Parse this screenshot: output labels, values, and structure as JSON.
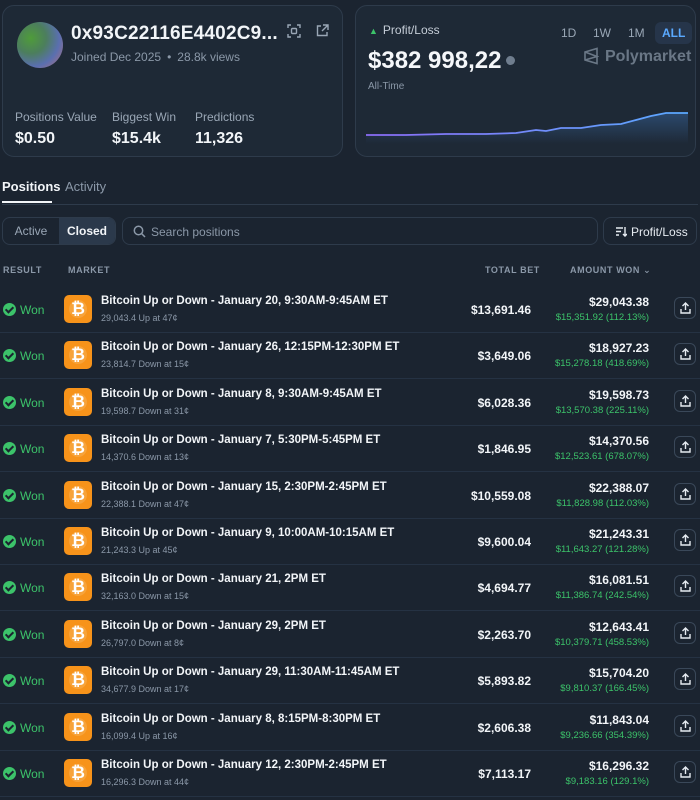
{
  "profile": {
    "address": "0x93C22116E4402C9...",
    "joined": "Joined Dec 2025",
    "views": "28.8k views",
    "stats": [
      {
        "label": "Positions Value",
        "value": "$0.50"
      },
      {
        "label": "Biggest Win",
        "value": "$15.4k"
      },
      {
        "label": "Predictions",
        "value": "11,326"
      }
    ]
  },
  "pnl": {
    "label": "Profit/Loss",
    "value": "$382 998,22",
    "period": "All-Time",
    "ranges": [
      "1D",
      "1W",
      "1M",
      "ALL"
    ],
    "active_range": "ALL",
    "brand": "Polymarket",
    "line_color": "#8b6cf6",
    "line_color_end": "#5aa9ff"
  },
  "tabs": {
    "positions": "Positions",
    "activity": "Activity"
  },
  "filters": {
    "active": "Active",
    "closed": "Closed",
    "search_placeholder": "Search positions",
    "sort_label": "Profit/Loss"
  },
  "table": {
    "headers": {
      "result": "RESULT",
      "market": "MARKET",
      "total_bet": "TOTAL BET",
      "amount_won": "AMOUNT WON"
    },
    "rows": [
      {
        "result": "Won",
        "title": "Bitcoin Up or Down - January 20, 9:30AM-9:45AM ET",
        "sub": "29,043.4 Up at 47¢",
        "bet": "$13,691.46",
        "won": "$29,043.38",
        "pct": "$15,351.92 (112.13%)"
      },
      {
        "result": "Won",
        "title": "Bitcoin Up or Down - January 26, 12:15PM-12:30PM ET",
        "sub": "23,814.7 Down at 15¢",
        "bet": "$3,649.06",
        "won": "$18,927.23",
        "pct": "$15,278.18 (418.69%)"
      },
      {
        "result": "Won",
        "title": "Bitcoin Up or Down - January 8, 9:30AM-9:45AM ET",
        "sub": "19,598.7 Down at 31¢",
        "bet": "$6,028.36",
        "won": "$19,598.73",
        "pct": "$13,570.38 (225.11%)"
      },
      {
        "result": "Won",
        "title": "Bitcoin Up or Down - January 7, 5:30PM-5:45PM ET",
        "sub": "14,370.6 Down at 13¢",
        "bet": "$1,846.95",
        "won": "$14,370.56",
        "pct": "$12,523.61 (678.07%)"
      },
      {
        "result": "Won",
        "title": "Bitcoin Up or Down - January 15, 2:30PM-2:45PM ET",
        "sub": "22,388.1 Down at 47¢",
        "bet": "$10,559.08",
        "won": "$22,388.07",
        "pct": "$11,828.98 (112.03%)"
      },
      {
        "result": "Won",
        "title": "Bitcoin Up or Down - January 9, 10:00AM-10:15AM ET",
        "sub": "21,243.3 Up at 45¢",
        "bet": "$9,600.04",
        "won": "$21,243.31",
        "pct": "$11,643.27 (121.28%)"
      },
      {
        "result": "Won",
        "title": "Bitcoin Up or Down - January 21, 2PM ET",
        "sub": "32,163.0 Down at 15¢",
        "bet": "$4,694.77",
        "won": "$16,081.51",
        "pct": "$11,386.74 (242.54%)"
      },
      {
        "result": "Won",
        "title": "Bitcoin Up or Down - January 29, 2PM ET",
        "sub": "26,797.0 Down at 8¢",
        "bet": "$2,263.70",
        "won": "$12,643.41",
        "pct": "$10,379.71 (458.53%)"
      },
      {
        "result": "Won",
        "title": "Bitcoin Up or Down - January 29, 11:30AM-11:45AM ET",
        "sub": "34,677.9 Down at 17¢",
        "bet": "$5,893.82",
        "won": "$15,704.20",
        "pct": "$9,810.37 (166.45%)"
      },
      {
        "result": "Won",
        "title": "Bitcoin Up or Down - January 8, 8:15PM-8:30PM ET",
        "sub": "16,099.4 Up at 16¢",
        "bet": "$2,606.38",
        "won": "$11,843.04",
        "pct": "$9,236.66 (354.39%)"
      },
      {
        "result": "Won",
        "title": "Bitcoin Up or Down - January 12, 2:30PM-2:45PM ET",
        "sub": "16,296.3 Down at 44¢",
        "bet": "$7,113.17",
        "won": "$16,296.32",
        "pct": "$9,183.16 (129.1%)"
      }
    ]
  }
}
